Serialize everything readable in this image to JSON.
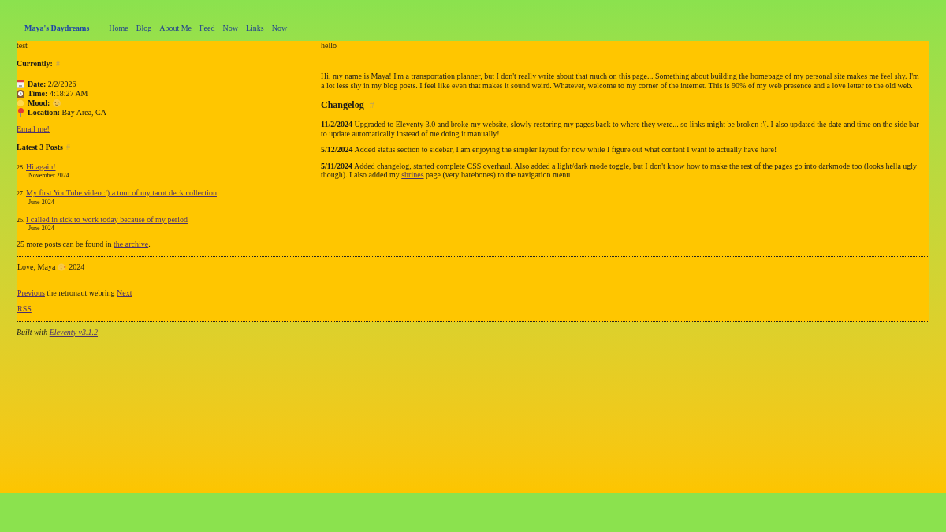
{
  "site_title": "Maya's Daydreams",
  "nav": [
    {
      "label": "Home",
      "selected": true
    },
    {
      "label": "Blog",
      "selected": false
    },
    {
      "label": "About Me",
      "selected": false
    },
    {
      "label": "Feed",
      "selected": false
    },
    {
      "label": "Now",
      "selected": false
    },
    {
      "label": "Links",
      "selected": false
    },
    {
      "label": "Now",
      "selected": false
    }
  ],
  "sidebar": {
    "intro": "test",
    "currently": {
      "heading": "Currently:",
      "anchor": "#",
      "items": [
        {
          "kind": "date",
          "text": "**Date:** 2/2/2026"
        },
        {
          "kind": "time",
          "text": "**Time:** 4:18:27 AM"
        },
        {
          "kind": "mood",
          "text": "**Mood:**"
        },
        {
          "kind": "location",
          "text": "**Location:** Bay Area, CA"
        }
      ]
    },
    "email_link": "Email me!",
    "latest_posts": {
      "heading": "Latest 3 Posts",
      "anchor": "#",
      "posts": [
        {
          "number": "28.",
          "title": "Hi again!",
          "date": "November 2024"
        },
        {
          "number": "27.",
          "title": "My first YouTube video :') a tour of my tarot deck collection",
          "date": "June 2024"
        },
        {
          "number": "26.",
          "title": "I called in sick to work today because of my period",
          "date": "June 2024"
        }
      ],
      "more": [
        {
          "kind": "text",
          "text": "25 more posts can be found in "
        },
        {
          "kind": "link",
          "text": "the archive"
        },
        {
          "kind": "text",
          "text": "."
        }
      ]
    }
  },
  "main": {
    "intro": "hello",
    "about": "Hi, my name is Maya! I'm a transportation planner, but I don't really write about that much on this page... Something about building the homepage of my personal site makes me feel shy. I'm a lot less shy in my blog posts. I feel like even that makes it sound weird. Whatever, welcome to my corner of the internet. This is 90% of my web presence and a love letter to the old web.",
    "changelog": {
      "heading": "Changelog",
      "anchor": "#",
      "entries": [
        {
          "date": "11/2/2024",
          "segments": [
            {
              "kind": "text",
              "text": " Upgraded to Eleventy 3.0 and broke my website, slowly restoring my pages back to where they were... so links might be broken :'(. I also updated the date and time on the side bar to update automatically instead of me doing it manually!"
            }
          ]
        },
        {
          "date": "5/12/2024",
          "segments": [
            {
              "kind": "text",
              "text": " Added status section to sidebar, I am enjoying the simpler layout for now while I figure out what content I want to actually have here!"
            }
          ]
        },
        {
          "date": "5/11/2024",
          "segments": [
            {
              "kind": "text",
              "text": " Added changelog, started complete CSS overhaul. Also added a light/dark mode toggle, but I don't know how to make the rest of the pages go into darkmode too (looks hella ugly though). I also added my "
            },
            {
              "kind": "link",
              "text": "shrines"
            },
            {
              "kind": "text",
              "text": " page (very barebones) to the navigation menu"
            }
          ]
        }
      ]
    }
  },
  "footer": {
    "signoff": "Love, Maya",
    "year": "2024",
    "webring": [
      {
        "kind": "link",
        "text": "Previous"
      },
      {
        "kind": "text",
        "text": " the retronaut webring "
      },
      {
        "kind": "link",
        "text": "Next"
      }
    ],
    "rss": "RSS"
  },
  "built_with": [
    {
      "kind": "text",
      "text": "Built with "
    },
    {
      "kind": "link",
      "text": "Eleventy v3.1.2"
    }
  ]
}
